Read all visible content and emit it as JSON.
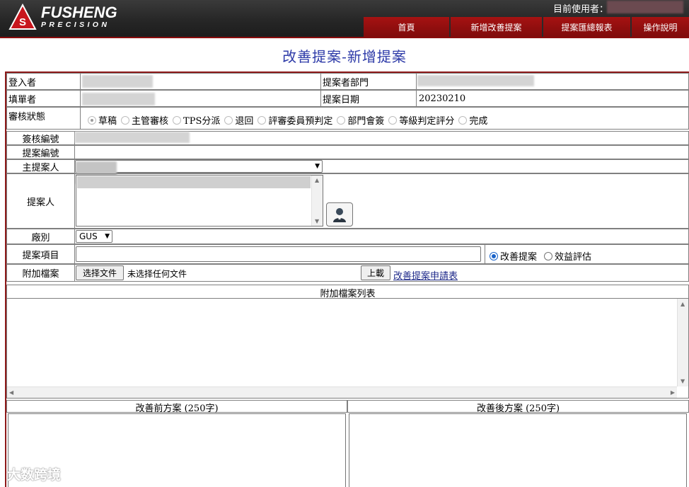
{
  "brand": {
    "name": "FUSHENG",
    "sub": "PRECISION"
  },
  "header": {
    "current_user_label": "目前使用者："
  },
  "nav": [
    {
      "label": "首頁"
    },
    {
      "label": "新增改善提案"
    },
    {
      "label": "提案匯總報表"
    },
    {
      "label": "操作說明"
    }
  ],
  "page_title": "改善提案-新增提案",
  "form": {
    "login_label": "登入者",
    "proposer_dept_label": "提案者部門",
    "filler_label": "填單者",
    "proposal_date_label": "提案日期",
    "proposal_date_value": "20230210",
    "review_status_label": "審核狀態",
    "statuses": [
      {
        "label": "草稿",
        "selected": true
      },
      {
        "label": "主管審核"
      },
      {
        "label": "TPS分派"
      },
      {
        "label": "退回"
      },
      {
        "label": "評審委員預判定"
      },
      {
        "label": "部門會簽"
      },
      {
        "label": "等級判定評分"
      },
      {
        "label": "完成"
      }
    ],
    "review_no_label": "簽核編號",
    "proposal_no_label": "提案編號",
    "main_proposer_label": "主提案人",
    "proposers_label": "提案人",
    "factory_label": "廠別",
    "factory_value": "GUS",
    "proposal_item_label": "提案項目",
    "item_types": [
      {
        "label": "改善提案",
        "selected": true
      },
      {
        "label": "效益評估"
      }
    ],
    "attachment_label": "附加檔案",
    "choose_file": "选择文件",
    "no_file": "未选择任何文件",
    "upload": "上載",
    "application_form_link": "改善提案申請表",
    "attachment_list_label": "附加檔案列表",
    "before_plan_label": "改善前方案 (250字)",
    "after_plan_label": "改善後方案 (250字)"
  },
  "watermark": "大数跨境",
  "colors": {
    "brand_red": "#a61212",
    "title_blue": "#2d3aa8",
    "frame_red": "#8e1a1a",
    "link_blue": "#1f2a8a"
  },
  "icons": [
    "logo-icon",
    "chevron-down-icon",
    "user-picker-icon",
    "scroll-up-icon",
    "scroll-down-icon",
    "scroll-left-icon",
    "scroll-right-icon"
  ]
}
